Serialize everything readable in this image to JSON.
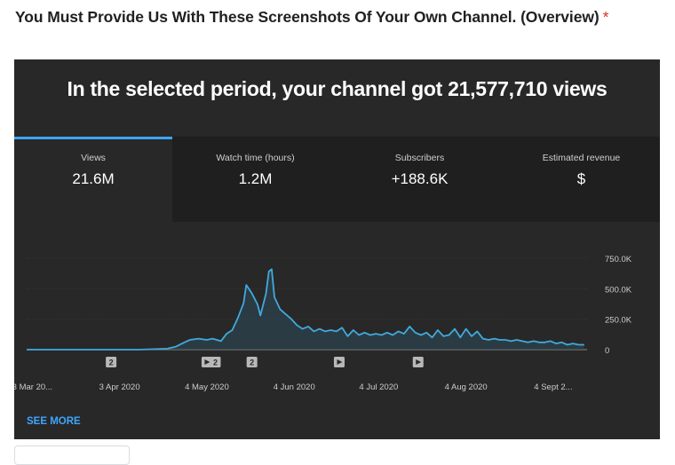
{
  "question": {
    "text": "You Must Provide Us With These Screenshots Of Your Own Channel. (Overview)",
    "required_mark": "*"
  },
  "panel": {
    "headline": "In the selected period, your channel got 21,577,710 views",
    "tabs": [
      {
        "label": "Views",
        "value": "21.6M",
        "active": true
      },
      {
        "label": "Watch time (hours)",
        "value": "1.2M",
        "active": false
      },
      {
        "label": "Subscribers",
        "value": "+188.6K",
        "active": false
      },
      {
        "label": "Estimated revenue",
        "value": "$",
        "active": false
      }
    ],
    "see_more": "SEE MORE"
  },
  "colors": {
    "accent": "#3ea6ff",
    "panel_bg": "#282828",
    "tab_bg": "#1f1f1f",
    "line": "#41a9dc",
    "required": "#d93025"
  },
  "chart_data": {
    "type": "area",
    "title": "",
    "xlabel": "",
    "ylabel": "",
    "y_ticks": [
      "750.0K",
      "500.0K",
      "250.0K",
      "0"
    ],
    "y_tick_values": [
      750000,
      500000,
      250000,
      0
    ],
    "ylim": [
      0,
      800000
    ],
    "x_ticks": [
      "3 Mar 20...",
      "3 Apr 2020",
      "4 May 2020",
      "4 Jun 2020",
      "4 Jul 2020",
      "4 Aug 2020",
      "4 Sept 2..."
    ],
    "x_tick_dates": [
      "2020-03-03",
      "2020-04-03",
      "2020-05-04",
      "2020-06-04",
      "2020-07-04",
      "2020-08-04",
      "2020-09-04"
    ],
    "xlim": [
      "2020-03-01",
      "2020-09-16"
    ],
    "grid": true,
    "series": [
      {
        "points": [
          [
            "2020-03-01",
            0
          ],
          [
            "2020-03-10",
            0
          ],
          [
            "2020-03-20",
            0
          ],
          [
            "2020-03-31",
            0
          ],
          [
            "2020-04-10",
            0
          ],
          [
            "2020-04-20",
            8000
          ],
          [
            "2020-04-23",
            25000
          ],
          [
            "2020-04-26",
            60000
          ],
          [
            "2020-04-28",
            80000
          ],
          [
            "2020-05-01",
            90000
          ],
          [
            "2020-05-04",
            80000
          ],
          [
            "2020-05-06",
            90000
          ],
          [
            "2020-05-09",
            70000
          ],
          [
            "2020-05-11",
            130000
          ],
          [
            "2020-05-13",
            160000
          ],
          [
            "2020-05-15",
            260000
          ],
          [
            "2020-05-17",
            380000
          ],
          [
            "2020-05-18",
            530000
          ],
          [
            "2020-05-20",
            460000
          ],
          [
            "2020-05-22",
            370000
          ],
          [
            "2020-05-23",
            280000
          ],
          [
            "2020-05-25",
            460000
          ],
          [
            "2020-05-26",
            640000
          ],
          [
            "2020-05-27",
            660000
          ],
          [
            "2020-05-28",
            430000
          ],
          [
            "2020-05-30",
            330000
          ],
          [
            "2020-06-01",
            290000
          ],
          [
            "2020-06-03",
            250000
          ],
          [
            "2020-06-05",
            200000
          ],
          [
            "2020-06-07",
            170000
          ],
          [
            "2020-06-09",
            190000
          ],
          [
            "2020-06-11",
            150000
          ],
          [
            "2020-06-13",
            170000
          ],
          [
            "2020-06-15",
            150000
          ],
          [
            "2020-06-17",
            160000
          ],
          [
            "2020-06-19",
            150000
          ],
          [
            "2020-06-21",
            180000
          ],
          [
            "2020-06-23",
            110000
          ],
          [
            "2020-06-25",
            160000
          ],
          [
            "2020-06-27",
            120000
          ],
          [
            "2020-06-29",
            140000
          ],
          [
            "2020-07-01",
            120000
          ],
          [
            "2020-07-03",
            130000
          ],
          [
            "2020-07-05",
            120000
          ],
          [
            "2020-07-07",
            140000
          ],
          [
            "2020-07-09",
            120000
          ],
          [
            "2020-07-11",
            150000
          ],
          [
            "2020-07-13",
            130000
          ],
          [
            "2020-07-15",
            190000
          ],
          [
            "2020-07-17",
            140000
          ],
          [
            "2020-07-19",
            120000
          ],
          [
            "2020-07-21",
            140000
          ],
          [
            "2020-07-23",
            100000
          ],
          [
            "2020-07-25",
            160000
          ],
          [
            "2020-07-27",
            110000
          ],
          [
            "2020-07-29",
            120000
          ],
          [
            "2020-07-31",
            170000
          ],
          [
            "2020-08-02",
            100000
          ],
          [
            "2020-08-04",
            170000
          ],
          [
            "2020-08-06",
            110000
          ],
          [
            "2020-08-08",
            150000
          ],
          [
            "2020-08-10",
            90000
          ],
          [
            "2020-08-12",
            80000
          ],
          [
            "2020-08-14",
            90000
          ],
          [
            "2020-08-16",
            80000
          ],
          [
            "2020-08-18",
            80000
          ],
          [
            "2020-08-20",
            70000
          ],
          [
            "2020-08-22",
            80000
          ],
          [
            "2020-08-24",
            70000
          ],
          [
            "2020-08-26",
            60000
          ],
          [
            "2020-08-28",
            70000
          ],
          [
            "2020-08-30",
            60000
          ],
          [
            "2020-09-01",
            60000
          ],
          [
            "2020-09-03",
            70000
          ],
          [
            "2020-09-05",
            50000
          ],
          [
            "2020-09-07",
            60000
          ],
          [
            "2020-09-09",
            40000
          ],
          [
            "2020-09-11",
            50000
          ],
          [
            "2020-09-13",
            40000
          ],
          [
            "2020-09-15",
            40000
          ]
        ]
      }
    ],
    "markers": [
      {
        "date": "2020-03-31",
        "kind": "count",
        "label": "2"
      },
      {
        "date": "2020-05-04",
        "kind": "play",
        "label": ""
      },
      {
        "date": "2020-05-07",
        "kind": "count",
        "label": "2"
      },
      {
        "date": "2020-05-20",
        "kind": "count",
        "label": "2"
      },
      {
        "date": "2020-06-20",
        "kind": "play",
        "label": ""
      },
      {
        "date": "2020-07-18",
        "kind": "play",
        "label": ""
      }
    ]
  }
}
